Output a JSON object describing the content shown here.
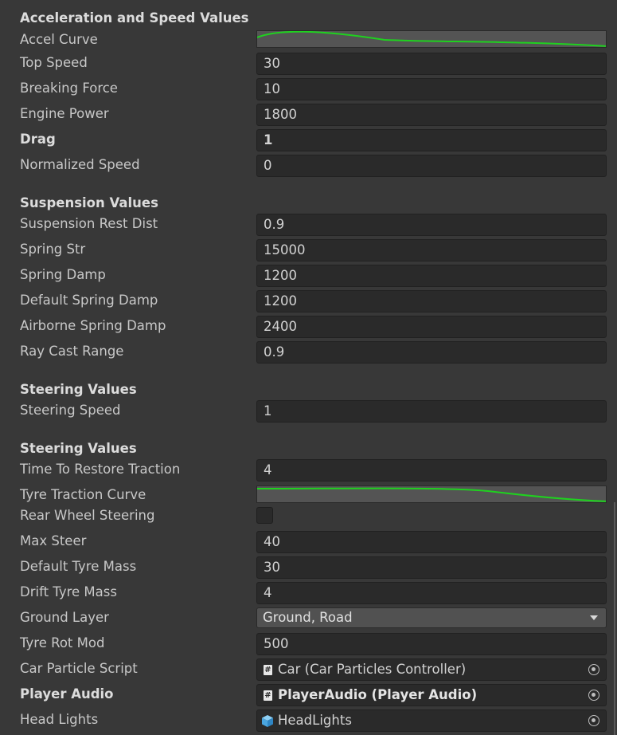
{
  "sections": {
    "accel": {
      "header": "Acceleration and Speed Values",
      "accel_curve_label": "Accel Curve",
      "top_speed": {
        "label": "Top Speed",
        "value": "30"
      },
      "breaking_force": {
        "label": "Breaking Force",
        "value": "10"
      },
      "engine_power": {
        "label": "Engine Power",
        "value": "1800"
      },
      "drag": {
        "label": "Drag",
        "value": "1"
      },
      "normalized_speed": {
        "label": "Normalized Speed",
        "value": "0"
      }
    },
    "suspension": {
      "header": "Suspension Values",
      "rest_dist": {
        "label": "Suspension Rest Dist",
        "value": "0.9"
      },
      "spring_str": {
        "label": "Spring Str",
        "value": "15000"
      },
      "spring_damp": {
        "label": "Spring Damp",
        "value": "1200"
      },
      "default_spring_damp": {
        "label": "Default Spring Damp",
        "value": "1200"
      },
      "airborne_spring_damp": {
        "label": "Airborne Spring Damp",
        "value": "2400"
      },
      "ray_cast_range": {
        "label": "Ray Cast Range",
        "value": "0.9"
      }
    },
    "steering": {
      "header": "Steering Values",
      "steering_speed": {
        "label": "Steering Speed",
        "value": "1"
      }
    },
    "steering2": {
      "header": "Steering Values",
      "time_restore": {
        "label": "Time To Restore Traction",
        "value": "4"
      },
      "tyre_curve_label": "Tyre Traction Curve",
      "rear_wheel_label": "Rear Wheel Steering",
      "max_steer": {
        "label": "Max Steer",
        "value": "40"
      },
      "default_tyre_mass": {
        "label": "Default Tyre Mass",
        "value": "30"
      },
      "drift_tyre_mass": {
        "label": "Drift Tyre Mass",
        "value": "4"
      },
      "ground_layer": {
        "label": "Ground Layer",
        "value": "Ground, Road"
      },
      "tyre_rot_mod": {
        "label": "Tyre Rot Mod",
        "value": "500"
      },
      "car_particle": {
        "label": "Car Particle Script",
        "value": "Car (Car Particles Controller)"
      },
      "player_audio": {
        "label": "Player Audio",
        "value": "PlayerAudio (Player Audio)"
      },
      "head_lights": {
        "label": "Head Lights",
        "value": "HeadLights"
      }
    }
  },
  "icons": {
    "script": "script-icon",
    "gameobject": "cube-icon",
    "picker": "object-picker-icon",
    "dropdown": "dropdown-arrow-icon"
  },
  "colors": {
    "curve": "#1fd11f",
    "background": "#383838",
    "field": "#2a2a2a"
  }
}
